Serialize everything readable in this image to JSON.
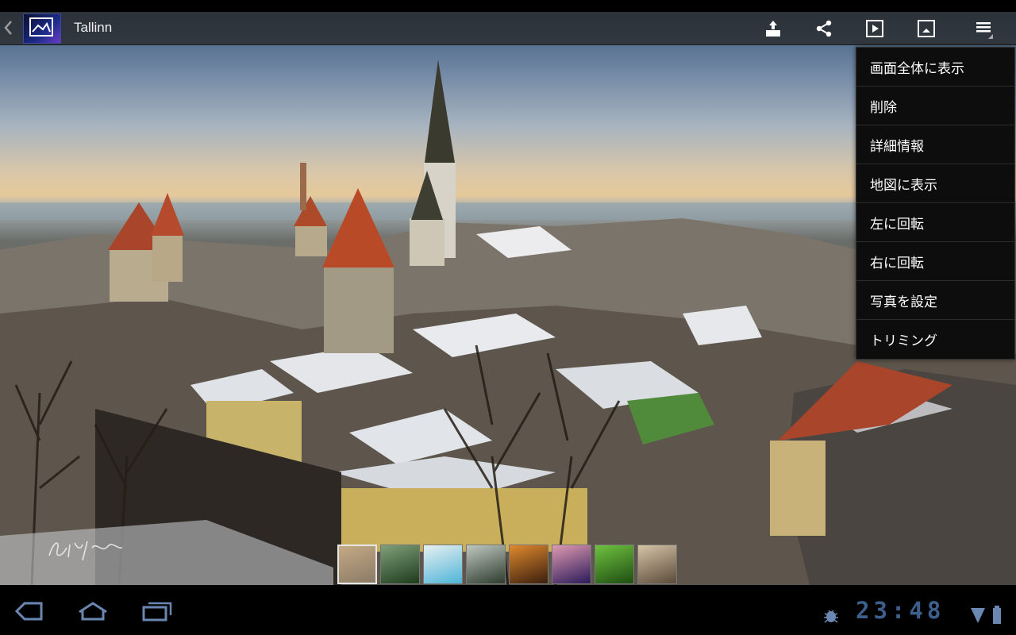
{
  "action_bar": {
    "title": "Tallinn",
    "icons": [
      "back-chevron-icon",
      "gallery-app-icon",
      "share-upload-icon",
      "share-icon",
      "slideshow-icon",
      "set-picture-icon",
      "overflow-menu-icon"
    ]
  },
  "menu": {
    "items": [
      {
        "label": "画面全体に表示"
      },
      {
        "label": "削除"
      },
      {
        "label": "詳細情報"
      },
      {
        "label": "地図に表示"
      },
      {
        "label": "左に回転"
      },
      {
        "label": "右に回転"
      },
      {
        "label": "写真を設定"
      },
      {
        "label": "トリミング"
      }
    ]
  },
  "filmstrip": {
    "thumbnails": [
      {
        "name": "tallinn-thumb",
        "colors": [
          "#8a7a66",
          "#c4aa85"
        ],
        "selected": true
      },
      {
        "name": "palm-tree-thumb",
        "colors": [
          "#1e3b1c",
          "#7fa07a"
        ],
        "selected": false
      },
      {
        "name": "beach-thumb",
        "colors": [
          "#4fb4d8",
          "#e8f0f0"
        ],
        "selected": false
      },
      {
        "name": "pier-thumb",
        "colors": [
          "#2d3b2e",
          "#c0c8c0"
        ],
        "selected": false
      },
      {
        "name": "sunset-bridge-thumb",
        "colors": [
          "#3a1e0e",
          "#e08a2e"
        ],
        "selected": false
      },
      {
        "name": "purple-sunset-thumb",
        "colors": [
          "#2a1a5a",
          "#e09ab0"
        ],
        "selected": false
      },
      {
        "name": "green-leaves-thumb",
        "colors": [
          "#1f4d12",
          "#6fc240"
        ],
        "selected": false
      },
      {
        "name": "coastal-tower-thumb",
        "colors": [
          "#5a4a3a",
          "#d6c4a6"
        ],
        "selected": false
      }
    ]
  },
  "system_bar": {
    "clock": "23:48",
    "colors": {
      "clock": "#3d5f8c",
      "icons": "#6a87b2"
    }
  }
}
